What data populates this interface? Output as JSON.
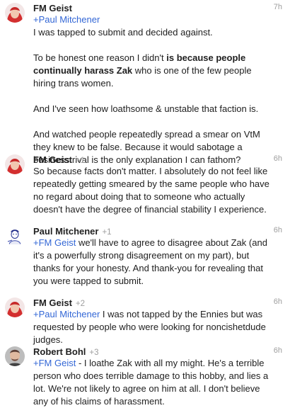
{
  "comments": [
    {
      "author": "FM Geist",
      "plus_count": "",
      "time": "7h",
      "mention": "+Paul Mitchener",
      "paragraphs": [
        {
          "pre": "I was tapped to submit and decided against.",
          "bold": "",
          "post": ""
        },
        {
          "pre": "To be honest one reason I didn't ",
          "bold": "is because people continually harass Zak",
          "post": " who is one of the few people hiring trans women."
        },
        {
          "pre": "And I've seen how loathsome & unstable that faction is.",
          "bold": "",
          "post": ""
        },
        {
          "pre": "And watched people repeatedly spread a smear on VtM they knew to be false. Because it would sabotage a business rival is the only explanation I can fathom?",
          "bold": "",
          "post": ""
        }
      ]
    },
    {
      "author": "FM Geist",
      "plus_count": "+1",
      "time": "6h",
      "mention": "",
      "text": "So because facts don't matter. I absolutely do not feel like repeatedly getting smeared by the same people who have no regard about doing that to someone who actually doesn't have the degree of financial stability I experience."
    },
    {
      "author": "Paul Mitchener",
      "plus_count": "+1",
      "time": "6h",
      "mention": "+FM Geist",
      "text": " we'll have to agree to disagree about Zak (and it's a powerfully strong disagreement on my part), but thanks for your honesty. And thank-you for revealing that you were tapped to submit."
    },
    {
      "author": "FM Geist",
      "plus_count": "+2",
      "time": "6h",
      "mention": "+Paul Mitchener",
      "text": " I was not tapped by the Ennies but was requested by people who were looking for noncishetdude judges."
    },
    {
      "author": "Robert Bohl",
      "plus_count": "+3",
      "time": "6h",
      "mention": "+FM Geist",
      "text": " - I loathe Zak with all my might. He's a terrible person who does terrible damage to this hobby, and lies a lot. We're not likely to agree on him at all. I don't believe any of his claims of harassment."
    }
  ],
  "colors": {
    "mention": "#3367d6",
    "meta": "#9e9e9e",
    "text": "#212121",
    "fm_hair": "#e53935"
  }
}
